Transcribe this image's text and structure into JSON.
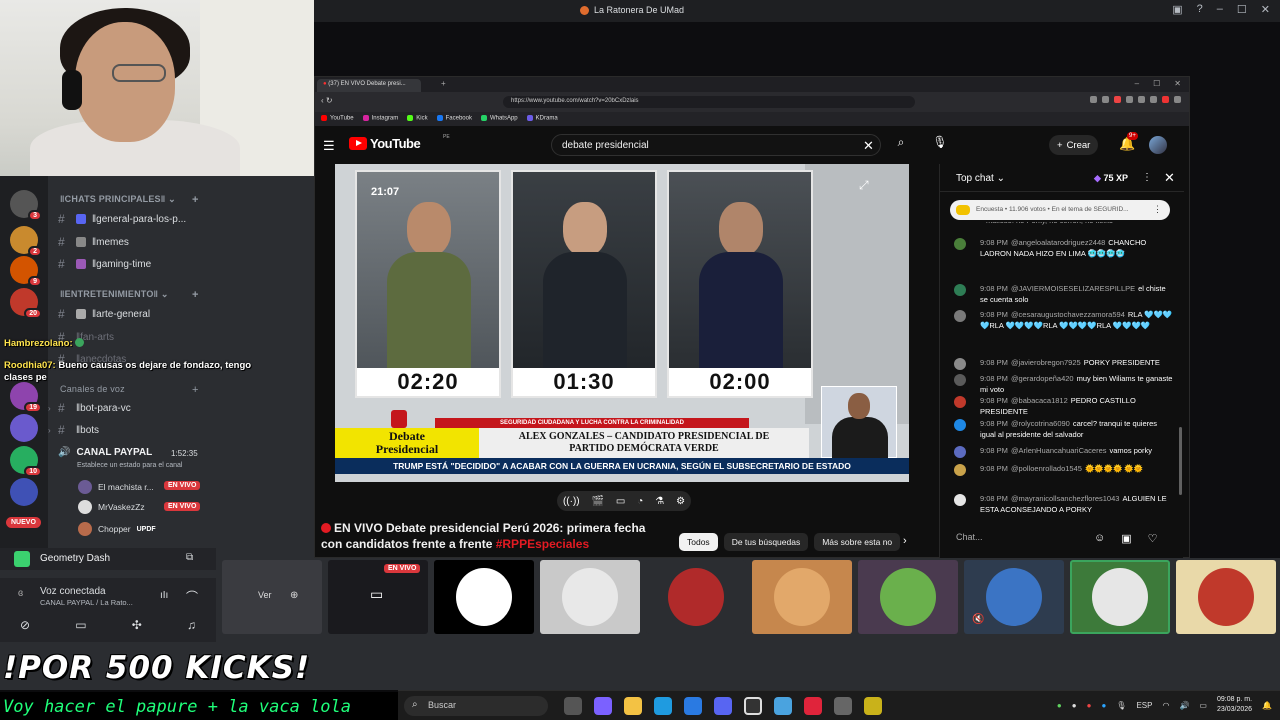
{
  "window": {
    "title": "La Ratonera De UMad"
  },
  "discord": {
    "categories": [
      {
        "label": "‖CHATS PRINCIPALES‖"
      },
      {
        "label": "‖ENTRETENIMIENTO‖"
      },
      {
        "label": "Canales de voz"
      }
    ],
    "channels": [
      {
        "label": "‖general-para-los-p..."
      },
      {
        "label": "‖memes"
      },
      {
        "label": "‖gaming-time"
      },
      {
        "label": "‖arte-general"
      },
      {
        "label": "‖fan-arts"
      },
      {
        "label": "‖anecdotas"
      },
      {
        "label": "‖bot-para-vc"
      },
      {
        "label": "‖bots"
      }
    ],
    "server_badges": [
      "3",
      "2",
      "9",
      "20",
      "19",
      "10"
    ],
    "new_badge": "NUEVO",
    "voice_channel": {
      "name": "CANAL PAYPAL",
      "timer": "1:52:35",
      "status": "Establece un estado para el canal",
      "users": [
        {
          "name": "El machista r...",
          "live": "EN VIVO"
        },
        {
          "name": "MrVaskezZz",
          "live": "EN VIVO"
        },
        {
          "name": "Chopper",
          "badge": "UPDF"
        }
      ]
    },
    "game": "Geometry Dash",
    "voice_connected": "Voz conectada",
    "voice_location": "CANAL PAYPAL / La Rato...",
    "overlay_chat": [
      {
        "name": "Hambrezolano:",
        "text": ""
      },
      {
        "name": "Roodhia07:",
        "text": "Bueno causas os dejare de fondazo, tengo clases pe"
      }
    ]
  },
  "stream_overlay": {
    "kicks": "!POR 500 KICKS!",
    "ticker": "Voy hacer el papure + la vaca lola"
  },
  "browser": {
    "tab_count": "(37)",
    "tab_title": "EN VIVO Debate presi...",
    "url": "https://www.youtube.com/watch?v=20bCxDzlais",
    "bookmarks": [
      "YouTube",
      "Instagram",
      "Kick",
      "Facebook",
      "WhatsApp",
      "KDrama"
    ]
  },
  "youtube": {
    "logo": "YouTube",
    "country": "PE",
    "search_query": "debate presidencial",
    "create_label": "Crear",
    "notif_count": "9+",
    "video": {
      "clock": "21:07",
      "timers": [
        "02:20",
        "01:30",
        "02:00"
      ],
      "red_bar": "SEGURIDAD CIUDADANA Y LUCHA CONTRA LA CRIMINALIDAD",
      "tag_line1": "Debate",
      "tag_line2": "Presidencial",
      "name_line1": "ALEX GONZALES – CANDIDATO PRESIDENCIAL DE",
      "name_line2": "PARTIDO DEMÓCRATA VERDE",
      "ticker": "TRUMP ESTÁ \"DECIDIDO\" A ACABAR CON LA GUERRA EN UCRANIA, SEGÚN EL SUBSECRETARIO DE ESTADO"
    },
    "title_line1": "EN VIVO Debate presidencial Perú 2026: primera fecha",
    "title_line2": "con candidatos frente a frente",
    "title_hashtag": "#RPPEspeciales",
    "chips": [
      "Todos",
      "De tus búsquedas",
      "Más sobre esta no"
    ]
  },
  "live_chat": {
    "header": "Top chat",
    "xp": "75 XP",
    "poll": "Encuesta • 11.906 votos • En el tema de SEGURID...",
    "input_placeholder": "Chat...",
    "messages": [
      {
        "time": "",
        "author": "",
        "text": "malioso. no Porky, no cerron, no keiko",
        "color": "#555"
      },
      {
        "time": "9:08 PM",
        "author": "@angeloalatarodriguez2448",
        "text": "CHANCHO LADRON NADA HIZO EN LIMA 🥶🥶🥶🥶",
        "color": "#4a7f3a"
      },
      {
        "time": "9:08 PM",
        "author": "@JAVIERMOISESELIZARESPILLPE",
        "text": "el chiste se cuenta solo",
        "color": "#2e7d55"
      },
      {
        "time": "9:08 PM",
        "author": "@cesaraugustochavezzamora594",
        "text": "RLA 🩵🩵🩵🩵RLA 🩵🩵🩵🩵RLA 🩵🩵🩵🩵RLA 🩵🩵🩵🩵",
        "color": "#7a7a7a"
      },
      {
        "time": "9:08 PM",
        "author": "@javierobregon7925",
        "text": "PORKY PRESIDENTE",
        "color": "#8a8a8a"
      },
      {
        "time": "9:08 PM",
        "author": "@gerardopeña420",
        "text": "muy bien Wiliams te ganaste mi voto",
        "color": "#5a5a5a"
      },
      {
        "time": "9:08 PM",
        "author": "@babacaca1812",
        "text": "PEDRO CASTILLO PRESIDENTE",
        "color": "#c0392b"
      },
      {
        "time": "9:08 PM",
        "author": "@rolycotrina6090",
        "text": "carcel? tranqui te quieres igual al presidente del salvador",
        "color": "#1e88e5"
      },
      {
        "time": "9:08 PM",
        "author": "@ArlenHuancahuariCaceres",
        "text": "vamos porky",
        "color": "#5c6bc0"
      },
      {
        "time": "9:08 PM",
        "author": "@polloenrollado1545",
        "text": "🌞🌞🌞🌞 🌞🌞",
        "color": "#c9a24a"
      },
      {
        "time": "9:08 PM",
        "author": "@mayranicollsanchezflores1043",
        "text": "ALGUIEN LE ESTA ACONSEJANDO A PORKY",
        "color": "#e6e6e6"
      }
    ]
  },
  "activity": {
    "view_label": "Ver",
    "live_label": "EN VIVO"
  },
  "taskbar": {
    "search_placeholder": "Buscar",
    "lang": "ESP",
    "time": "09:08 p. m.",
    "date": "23/03/2026"
  }
}
